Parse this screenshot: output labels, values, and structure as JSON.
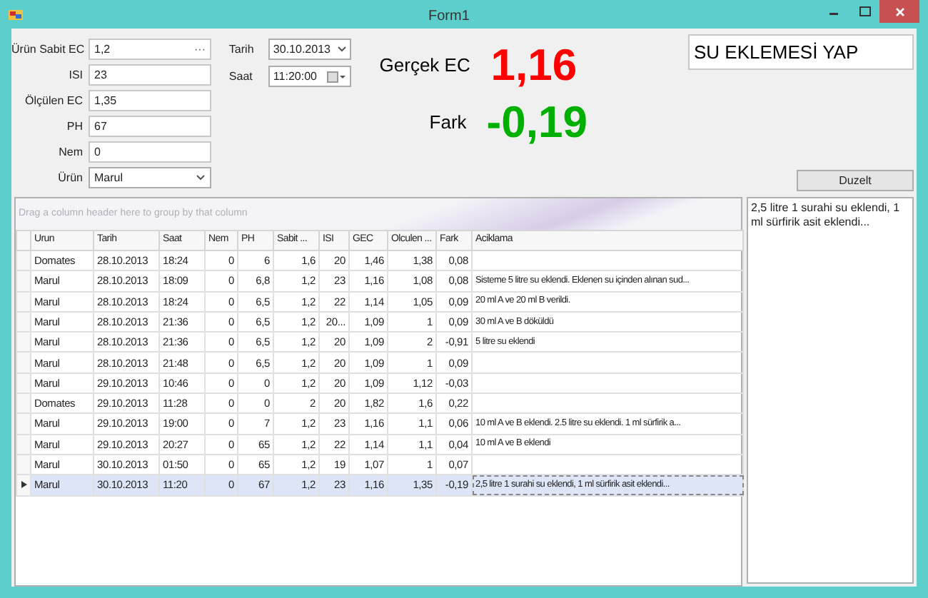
{
  "window": {
    "title": "Form1"
  },
  "fields": [
    {
      "label": "Ürün Sabit EC",
      "value": "1,2",
      "kind": "ellipsis",
      "button": "···"
    },
    {
      "label": "ISI",
      "value": "23",
      "kind": "text"
    },
    {
      "label": "Ölçülen EC",
      "value": "1,35",
      "kind": "text"
    },
    {
      "label": "PH",
      "value": "67",
      "kind": "text"
    },
    {
      "label": "Nem",
      "value": "0",
      "kind": "text"
    },
    {
      "label": "Ürün",
      "value": "Marul",
      "kind": "combo"
    }
  ],
  "date": {
    "label": "Tarih",
    "value": "30.10.2013"
  },
  "time": {
    "label": "Saat",
    "value": "11:20:00"
  },
  "gercek_ec": {
    "label": "Gerçek EC",
    "value": "1,16",
    "color": "#ff0000"
  },
  "fark": {
    "label": "Fark",
    "value": "-0,19",
    "color": "#00b000"
  },
  "advice": "SU EKLEMESİ YAP",
  "duzelt_button": "Duzelt",
  "group_panel": "Drag a column header here to group by that column",
  "columns": [
    {
      "label": "Urun",
      "kind": "text"
    },
    {
      "label": "Tarih",
      "kind": "text"
    },
    {
      "label": "Saat",
      "kind": "text"
    },
    {
      "label": "Nem",
      "kind": "number"
    },
    {
      "label": "PH",
      "kind": "number"
    },
    {
      "label": "Sabit ...",
      "kind": "number"
    },
    {
      "label": "ISI",
      "kind": "number"
    },
    {
      "label": "GEC",
      "kind": "number"
    },
    {
      "label": "Olculen ...",
      "kind": "number"
    },
    {
      "label": "Fark",
      "kind": "number"
    },
    {
      "label": "Aciklama",
      "kind": "text"
    }
  ],
  "rows": [
    {
      "selected": false,
      "cells": [
        "Domates",
        "28.10.2013",
        "18:24",
        "0",
        "6",
        "1,6",
        "20",
        "1,46",
        "1,38",
        "0,08",
        ""
      ]
    },
    {
      "selected": false,
      "cells": [
        "Marul",
        "28.10.2013",
        "18:09",
        "0",
        "6,8",
        "1,2",
        "23",
        "1,16",
        "1,08",
        "0,08",
        "Sisteme 5 litre su eklendi. Eklenen su içinden alınan sud..."
      ]
    },
    {
      "selected": false,
      "cells": [
        "Marul",
        "28.10.2013",
        "18:24",
        "0",
        "6,5",
        "1,2",
        "22",
        "1,14",
        "1,05",
        "0,09",
        "20 ml A ve 20 ml B verildi."
      ]
    },
    {
      "selected": false,
      "cells": [
        "Marul",
        "28.10.2013",
        "21:36",
        "0",
        "6,5",
        "1,2",
        "20...",
        "1,09",
        "1",
        "0,09",
        "30 ml A ve B döküldü"
      ]
    },
    {
      "selected": false,
      "cells": [
        "Marul",
        "28.10.2013",
        "21:36",
        "0",
        "6,5",
        "1,2",
        "20",
        "1,09",
        "2",
        "-0,91",
        "5 litre su eklendi"
      ]
    },
    {
      "selected": false,
      "cells": [
        "Marul",
        "28.10.2013",
        "21:48",
        "0",
        "6,5",
        "1,2",
        "20",
        "1,09",
        "1",
        "0,09",
        ""
      ]
    },
    {
      "selected": false,
      "cells": [
        "Marul",
        "29.10.2013",
        "10:46",
        "0",
        "0",
        "1,2",
        "20",
        "1,09",
        "1,12",
        "-0,03",
        ""
      ]
    },
    {
      "selected": false,
      "cells": [
        "Domates",
        "29.10.2013",
        "11:28",
        "0",
        "0",
        "2",
        "20",
        "1,82",
        "1,6",
        "0,22",
        ""
      ]
    },
    {
      "selected": false,
      "cells": [
        "Marul",
        "29.10.2013",
        "19:00",
        "0",
        "7",
        "1,2",
        "23",
        "1,16",
        "1,1",
        "0,06",
        "10 ml A ve B eklendi. 2.5 litre su eklendi. 1 ml  sürfirik a..."
      ]
    },
    {
      "selected": false,
      "cells": [
        "Marul",
        "29.10.2013",
        "20:27",
        "0",
        "65",
        "1,2",
        "22",
        "1,14",
        "1,1",
        "0,04",
        "10 ml A ve B eklendi"
      ]
    },
    {
      "selected": false,
      "cells": [
        "Marul",
        "30.10.2013",
        "01:50",
        "0",
        "65",
        "1,2",
        "19",
        "1,07",
        "1",
        "0,07",
        ""
      ]
    },
    {
      "selected": true,
      "cells": [
        "Marul",
        "30.10.2013",
        "11:20",
        "0",
        "67",
        "1,2",
        "23",
        "1,16",
        "1,35",
        "-0,19",
        "2,5 litre 1 surahi su eklendi, 1 ml sürfirik asit eklendi..."
      ]
    }
  ],
  "notes": "2,5 litre 1 surahi su eklendi, 1 ml sürfirik asit eklendi..."
}
